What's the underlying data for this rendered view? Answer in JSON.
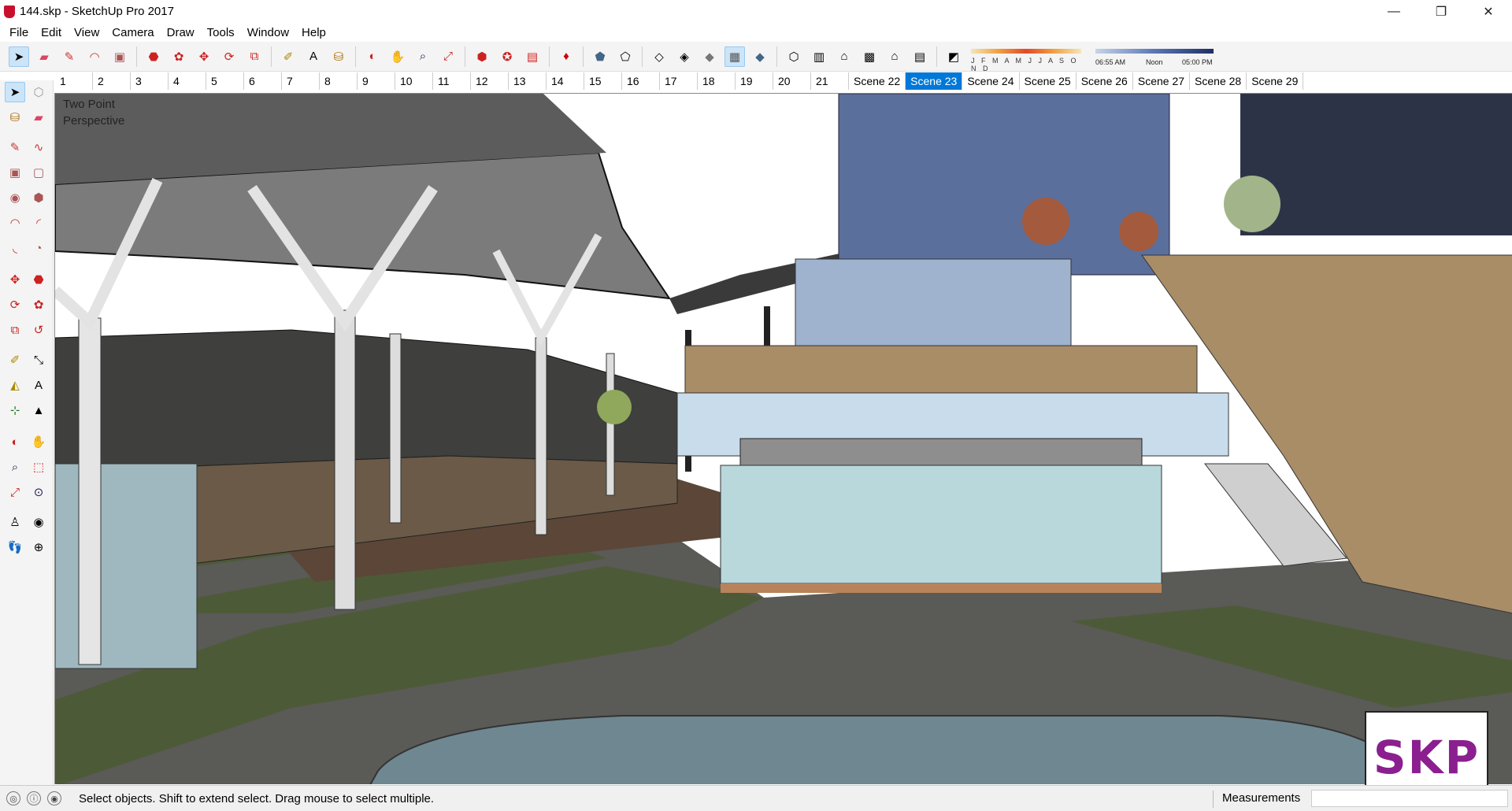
{
  "window": {
    "title": "144.skp - SketchUp Pro 2017",
    "minimize": "—",
    "restore": "❐",
    "close": "✕"
  },
  "menu": [
    "File",
    "Edit",
    "View",
    "Camera",
    "Draw",
    "Tools",
    "Window",
    "Help"
  ],
  "shadows": {
    "months": "J F M A M J J A S O N D",
    "time_start": "06:55 AM",
    "time_noon": "Noon",
    "time_end": "05:00 PM"
  },
  "scenes": {
    "tabs": [
      "1",
      "2",
      "3",
      "4",
      "5",
      "6",
      "7",
      "8",
      "9",
      "10",
      "11",
      "12",
      "13",
      "14",
      "15",
      "16",
      "17",
      "18",
      "19",
      "20",
      "21",
      "Scene 22",
      "Scene 23",
      "Scene 24",
      "Scene 25",
      "Scene 26",
      "Scene 27",
      "Scene 28",
      "Scene 29"
    ],
    "active": "Scene 23"
  },
  "viewport": {
    "camera_label_line1": "Two Point",
    "camera_label_line2": "Perspective"
  },
  "logo": "SKP",
  "status": {
    "message": "Select objects. Shift to extend select. Drag mouse to select multiple.",
    "measurements_label": "Measurements",
    "measurements_value": ""
  },
  "colors": {
    "accent": "#0078d7",
    "logo": "#8b1f8f",
    "grass": "#4d5a37",
    "pavement": "#5a5a57",
    "water": "#6f8791",
    "stone": "#a88d67",
    "glass": "#b8d8dc"
  }
}
